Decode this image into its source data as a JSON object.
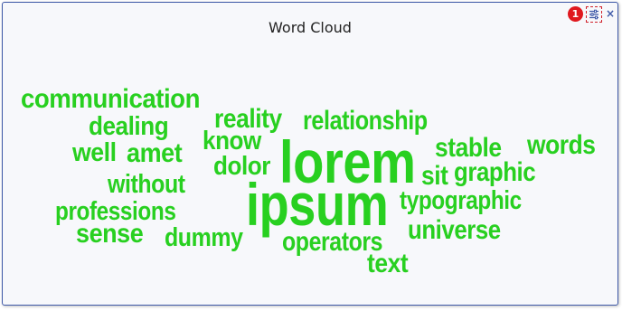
{
  "widget": {
    "title": "Word Cloud",
    "badge_count": "1",
    "settings_icon": "sliders-icon",
    "close_label": "×"
  },
  "colors": {
    "word": "#28d020",
    "badge": "#e0191f",
    "accent": "#3f5aa8"
  },
  "words": [
    "communication",
    "dealing",
    "reality",
    "relationship",
    "know",
    "well",
    "amet",
    "lorem",
    "stable",
    "words",
    "dolor",
    "sit",
    "graphic",
    "without",
    "ipsum",
    "typographic",
    "professions",
    "sense",
    "dummy",
    "operators",
    "universe",
    "text"
  ]
}
